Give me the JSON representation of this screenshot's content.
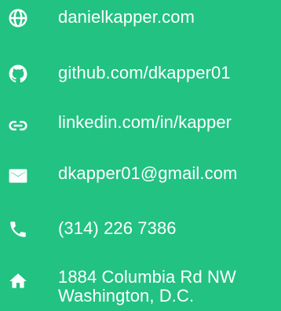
{
  "colors": {
    "background": "#22c282",
    "foreground": "#ffffff"
  },
  "contacts": [
    {
      "icon": "globe-icon",
      "text": "danielkapper.com"
    },
    {
      "icon": "github-icon",
      "text": "github.com/dkapper01"
    },
    {
      "icon": "link-icon",
      "text": "linkedin.com/in/kapper"
    },
    {
      "icon": "mail-icon",
      "text": "dkapper01@gmail.com"
    },
    {
      "icon": "phone-icon",
      "text": "(314) 226 7386"
    },
    {
      "icon": "home-icon",
      "lines": [
        "1884 Columbia Rd NW",
        "Washington, D.C."
      ]
    }
  ]
}
